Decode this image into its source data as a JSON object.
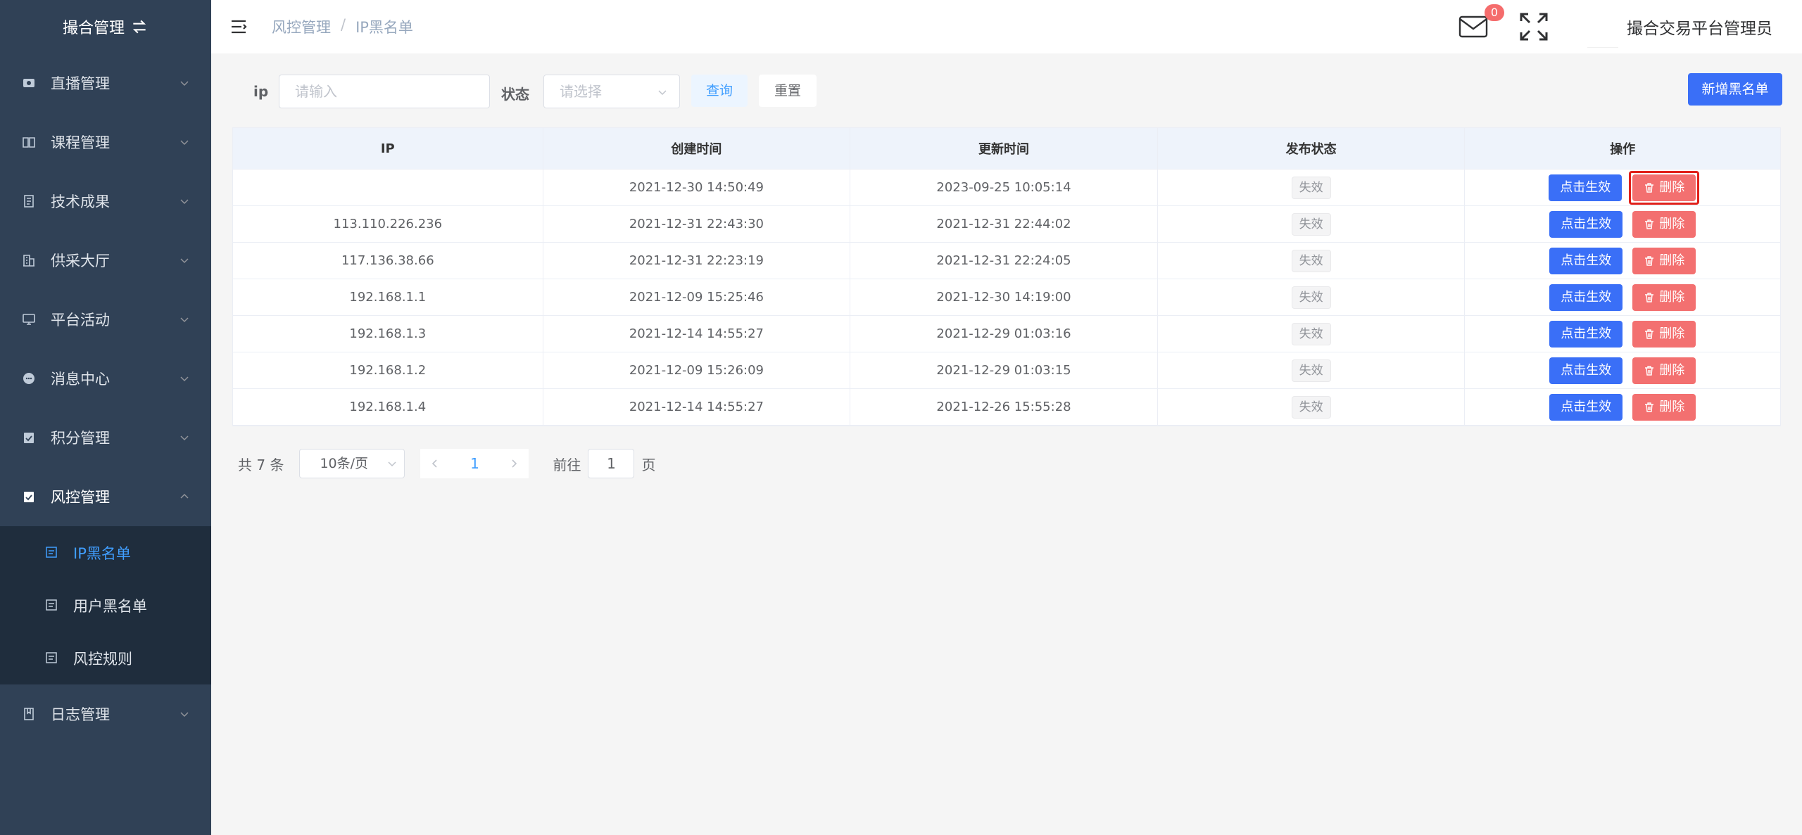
{
  "sidebar": {
    "logo_text": "撮合管理",
    "items": [
      {
        "label": "直播管理"
      },
      {
        "label": "课程管理"
      },
      {
        "label": "技术成果"
      },
      {
        "label": "供采大厅"
      },
      {
        "label": "平台活动"
      },
      {
        "label": "消息中心"
      },
      {
        "label": "积分管理"
      },
      {
        "label": "风控管理"
      }
    ],
    "sub_items": [
      {
        "label": "IP黑名单"
      },
      {
        "label": "用户黑名单"
      },
      {
        "label": "风控规则"
      }
    ],
    "last_item": {
      "label": "日志管理"
    }
  },
  "header": {
    "breadcrumb": [
      "风控管理",
      "IP黑名单"
    ],
    "breadcrumb_sep": "/",
    "mail_badge": "0",
    "username": "撮合交易平台管理员"
  },
  "search": {
    "ip_label": "ip",
    "ip_placeholder": "请输入",
    "status_label": "状态",
    "status_placeholder": "请选择",
    "query_label": "查询",
    "reset_label": "重置",
    "add_label": "新增黑名单"
  },
  "table": {
    "columns": [
      "IP",
      "创建时间",
      "更新时间",
      "发布状态",
      "操作"
    ],
    "rows": [
      {
        "ip": "",
        "created": "2021-12-30 14:50:49",
        "updated": "2023-09-25 10:05:14",
        "status": "失效"
      },
      {
        "ip": "113.110.226.236",
        "created": "2021-12-31 22:43:30",
        "updated": "2021-12-31 22:44:02",
        "status": "失效"
      },
      {
        "ip": "117.136.38.66",
        "created": "2021-12-31 22:23:19",
        "updated": "2021-12-31 22:24:05",
        "status": "失效"
      },
      {
        "ip": "192.168.1.1",
        "created": "2021-12-09 15:25:46",
        "updated": "2021-12-30 14:19:00",
        "status": "失效"
      },
      {
        "ip": "192.168.1.3",
        "created": "2021-12-14 14:55:27",
        "updated": "2021-12-29 01:03:16",
        "status": "失效"
      },
      {
        "ip": "192.168.1.2",
        "created": "2021-12-09 15:26:09",
        "updated": "2021-12-29 01:03:15",
        "status": "失效"
      },
      {
        "ip": "192.168.1.4",
        "created": "2021-12-14 14:55:27",
        "updated": "2021-12-26 15:55:28",
        "status": "失效"
      }
    ],
    "enable_label": "点击生效",
    "delete_label": "删除"
  },
  "pagination": {
    "total_text": "共 7 条",
    "page_size": "10条/页",
    "current_page": "1",
    "goto_prefix": "前往",
    "goto_value": "1",
    "goto_suffix": "页"
  },
  "colors": {
    "sidebar_bg": "#304156",
    "submenu_bg": "#1f2d3d",
    "active": "#409eff",
    "primary_btn": "#3a6ff7",
    "danger_btn": "#f37070",
    "highlight": "#e0201a"
  }
}
